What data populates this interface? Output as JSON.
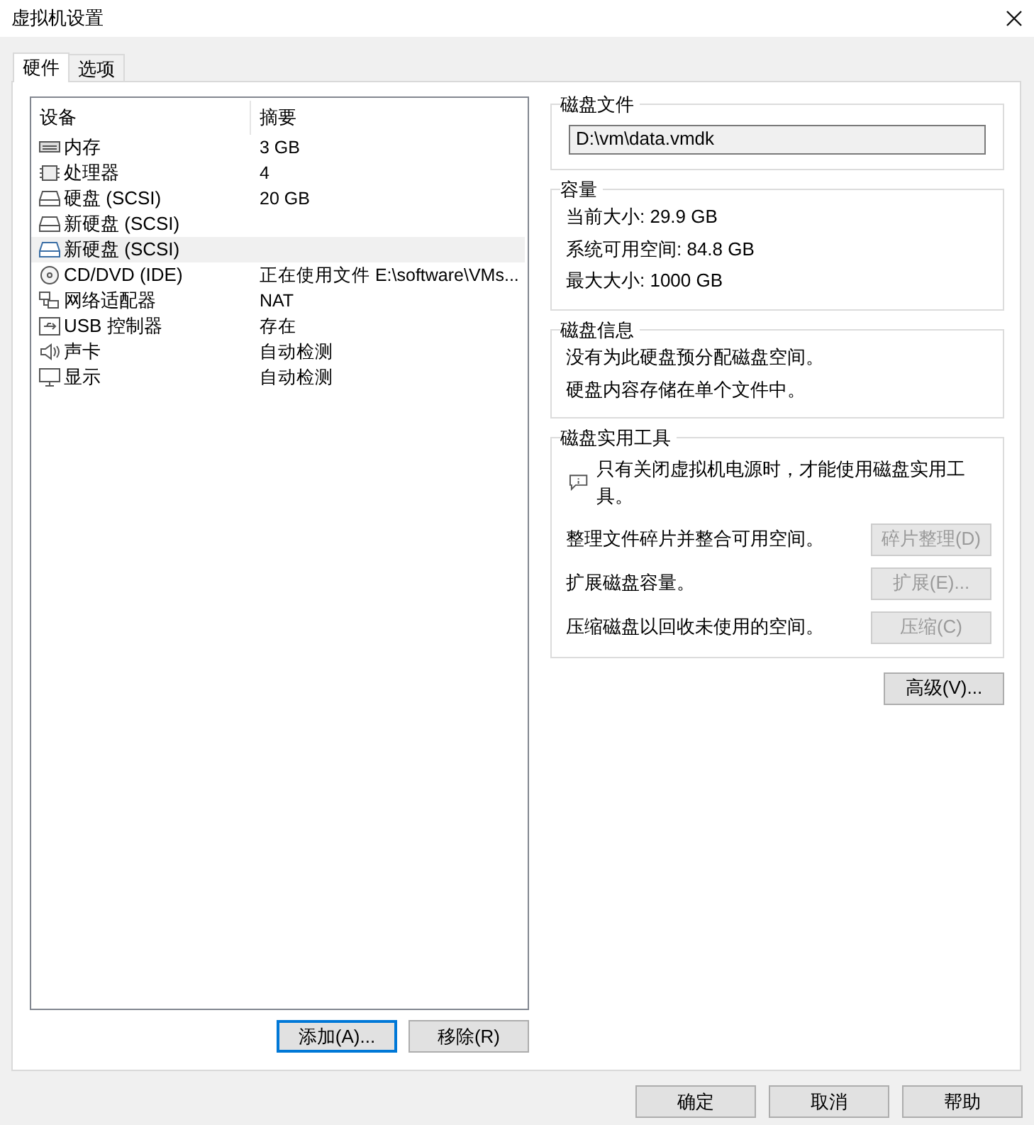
{
  "window": {
    "title": "虚拟机设置"
  },
  "tabs": [
    {
      "label": "硬件",
      "selected": true
    },
    {
      "label": "选项",
      "selected": false
    }
  ],
  "device_table": {
    "columns": [
      "设备",
      "摘要"
    ],
    "rows": [
      {
        "device": "内存",
        "summary": "3 GB",
        "selected": false
      },
      {
        "device": "处理器",
        "summary": "4",
        "selected": false
      },
      {
        "device": "硬盘 (SCSI)",
        "summary": "20 GB",
        "selected": false
      },
      {
        "device": "新硬盘 (SCSI)",
        "selected": false
      },
      {
        "device": "新硬盘 (SCSI)",
        "selected": true
      },
      {
        "device": "CD/DVD (IDE)",
        "summary": "正在使用文件 E:\\software\\VMs...",
        "selected": false
      },
      {
        "device": "网络适配器",
        "summary": "NAT",
        "selected": false
      },
      {
        "device": "USB 控制器",
        "summary": "存在",
        "selected": false
      },
      {
        "device": "声卡",
        "summary": "自动检测",
        "selected": false
      },
      {
        "device": "显示",
        "summary": "自动检测",
        "selected": false
      }
    ]
  },
  "list_buttons": [
    {
      "label": "添加(A)...",
      "focused": true
    },
    {
      "label": "移除(R)",
      "focused": false
    }
  ],
  "disk_file": {
    "title": "磁盘文件",
    "value": "D:\\vm\\data.vmdk"
  },
  "capacity": {
    "title": "容量",
    "lines": [
      "当前大小: 29.9 GB",
      "系统可用空间: 84.8 GB",
      "最大大小: 1000 GB"
    ]
  },
  "disk_info": {
    "title": "磁盘信息",
    "lines": [
      "没有为此硬盘预分配磁盘空间。",
      "硬盘内容存储在单个文件中。"
    ]
  },
  "disk_utilities": {
    "title": "磁盘实用工具",
    "notice": "只有关闭虚拟机电源时，才能使用磁盘实用工具。",
    "actions": [
      {
        "text": "整理文件碎片并整合可用空间。",
        "button": "碎片整理(D)",
        "disabled": true
      },
      {
        "text": "扩展磁盘容量。",
        "button": "扩展(E)...",
        "disabled": true
      },
      {
        "text": "压缩磁盘以回收未使用的空间。",
        "button": "压缩(C)",
        "disabled": true
      }
    ]
  },
  "advanced_button": "高级(V)...",
  "dialog_buttons": [
    "确定",
    "取消",
    "帮助"
  ]
}
